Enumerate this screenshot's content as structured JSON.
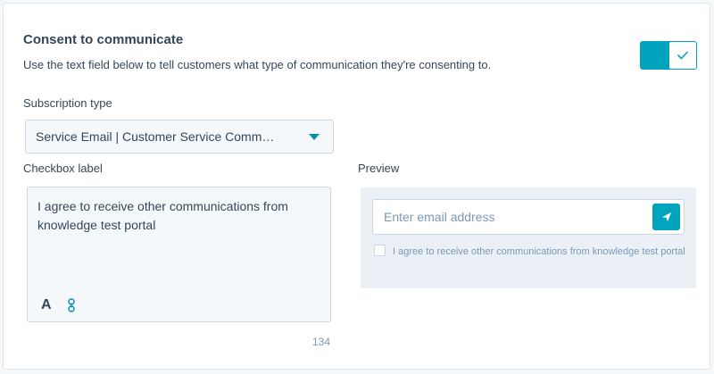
{
  "section": {
    "title": "Consent to communicate",
    "description": "Use the text field below to tell customers what type of communication they're consenting to."
  },
  "toggle": {
    "state": "on",
    "icon": "check-icon"
  },
  "subscription": {
    "label": "Subscription type",
    "selected": "Service Email | Customer Service Comm…"
  },
  "checkbox_label": {
    "label": "Checkbox label",
    "text": "I agree to receive other communications from knowledge test portal",
    "char_count": "134",
    "tools": {
      "format_icon": "A",
      "link_icon": "link-icon"
    }
  },
  "preview": {
    "label": "Preview",
    "email_placeholder": "Enter email address",
    "send_icon": "send-icon",
    "consent_text": "I agree to receive other communications from knowledge test portal"
  },
  "colors": {
    "accent": "#00a4bd",
    "text": "#33475b",
    "muted": "#7c98b6",
    "border": "#cbd6e2",
    "field_bg": "#f5f8fa",
    "preview_bg": "#eaf0f6"
  }
}
